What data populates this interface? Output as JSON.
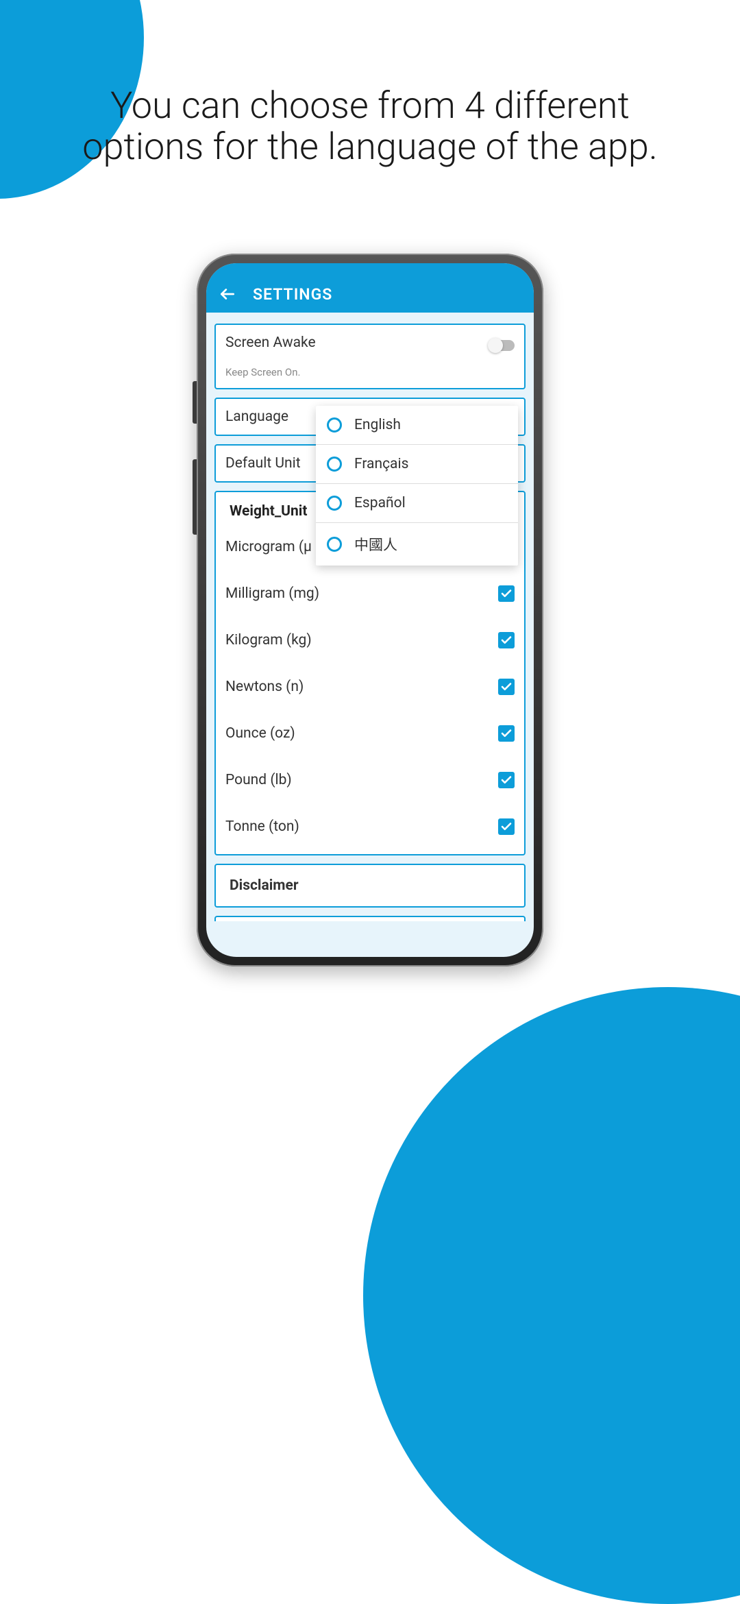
{
  "hero": {
    "text": "You can choose from 4 different options for the language of the app."
  },
  "header": {
    "title": "SETTINGS"
  },
  "screenAwake": {
    "title": "Screen Awake",
    "subtitle": "Keep Screen On."
  },
  "language": {
    "title": "Language",
    "options": [
      "English",
      "Français",
      "Español",
      "中國人"
    ]
  },
  "defaultUnit": {
    "title": "Default Unit"
  },
  "weightUnits": {
    "title": "Weight_Unit",
    "items": [
      "Microgram (µ",
      "Milligram (mg)",
      "Kilogram (kg)",
      "Newtons (n)",
      "Ounce (oz)",
      "Pound (lb)",
      "Tonne (ton)"
    ]
  },
  "disclaimer": {
    "title": "Disclaimer"
  },
  "colors": {
    "accent": "#0d9dd9"
  }
}
